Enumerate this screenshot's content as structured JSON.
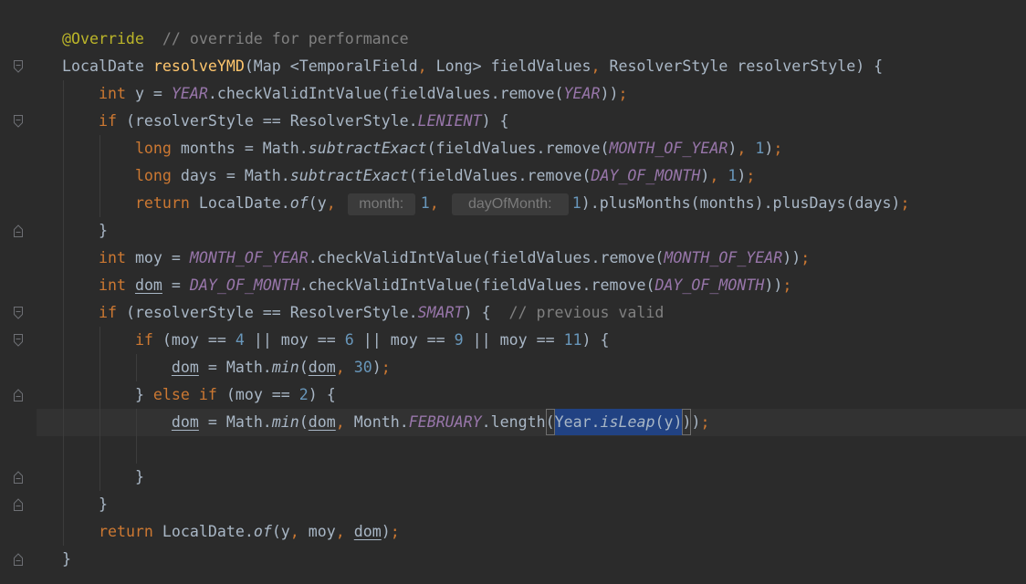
{
  "editor": {
    "colors": {
      "background": "#2B2B2B",
      "current_line": "#323232",
      "selection": "#214283",
      "text": "#A9B7C6",
      "keyword": "#CC7832",
      "annotation": "#BBB529",
      "method_declaration": "#FFC66D",
      "constant": "#9876AA",
      "number": "#6897BB",
      "comment": "#808080",
      "hint_text": "#7A7A7A",
      "hint_background": "#3B3B3B",
      "indent_guide": "#3C3C3C",
      "match_border": "#6E6E6E"
    },
    "caret_line": 14,
    "lines": [
      {
        "tokens": [
          {
            "t": "@Override",
            "c": "#BBB529"
          },
          {
            "t": "  "
          },
          {
            "t": "// override for performance",
            "c": "#808080"
          }
        ]
      },
      {
        "fold_icon": "fold-start-icon",
        "tokens": [
          {
            "t": "LocalDate "
          },
          {
            "t": "resolveYMD",
            "c": "#FFC66D"
          },
          {
            "t": "(Map <TemporalField"
          },
          {
            "t": ",",
            "c": "#CC7832"
          },
          {
            "t": " Long> fieldValues"
          },
          {
            "t": ",",
            "c": "#CC7832"
          },
          {
            "t": " ResolverStyle resolverStyle) {"
          }
        ]
      },
      {
        "tokens": [
          {
            "t": "    "
          },
          {
            "t": "int",
            "c": "#CC7832"
          },
          {
            "t": " y = "
          },
          {
            "t": "YEAR",
            "c": "#9876AA",
            "i": true
          },
          {
            "t": ".checkValidIntValue(fieldValues.remove("
          },
          {
            "t": "YEAR",
            "c": "#9876AA",
            "i": true
          },
          {
            "t": "))"
          },
          {
            "t": ";",
            "c": "#CC7832"
          }
        ]
      },
      {
        "fold_icon": "fold-start-icon",
        "tokens": [
          {
            "t": "    "
          },
          {
            "t": "if",
            "c": "#CC7832"
          },
          {
            "t": " (resolverStyle == ResolverStyle."
          },
          {
            "t": "LENIENT",
            "c": "#9876AA",
            "i": true
          },
          {
            "t": ") {"
          }
        ]
      },
      {
        "tokens": [
          {
            "t": "        "
          },
          {
            "t": "long",
            "c": "#CC7832"
          },
          {
            "t": " months = Math."
          },
          {
            "t": "subtractExact",
            "i": true
          },
          {
            "t": "(fieldValues.remove("
          },
          {
            "t": "MONTH_OF_YEAR",
            "c": "#9876AA",
            "i": true
          },
          {
            "t": ")"
          },
          {
            "t": ",",
            "c": "#CC7832"
          },
          {
            "t": " "
          },
          {
            "t": "1",
            "c": "#6897BB"
          },
          {
            "t": ")"
          },
          {
            "t": ";",
            "c": "#CC7832"
          }
        ]
      },
      {
        "tokens": [
          {
            "t": "        "
          },
          {
            "t": "long",
            "c": "#CC7832"
          },
          {
            "t": " days = Math."
          },
          {
            "t": "subtractExact",
            "i": true
          },
          {
            "t": "(fieldValues.remove("
          },
          {
            "t": "DAY_OF_MONTH",
            "c": "#9876AA",
            "i": true
          },
          {
            "t": ")"
          },
          {
            "t": ",",
            "c": "#CC7832"
          },
          {
            "t": " "
          },
          {
            "t": "1",
            "c": "#6897BB"
          },
          {
            "t": ")"
          },
          {
            "t": ";",
            "c": "#CC7832"
          }
        ]
      },
      {
        "tokens": [
          {
            "t": "        "
          },
          {
            "t": "return",
            "c": "#CC7832"
          },
          {
            "t": " LocalDate."
          },
          {
            "t": "of",
            "i": true
          },
          {
            "t": "(y"
          },
          {
            "t": ",",
            "c": "#CC7832"
          },
          {
            "t": " "
          },
          {
            "t": "month:",
            "hint": true
          },
          {
            "t": "1",
            "c": "#6897BB"
          },
          {
            "t": ",",
            "c": "#CC7832"
          },
          {
            "t": " "
          },
          {
            "t": "dayOfMonth:",
            "hint": true
          },
          {
            "t": "1",
            "c": "#6897BB"
          },
          {
            "t": ").plusMonths(months).plusDays(days)"
          },
          {
            "t": ";",
            "c": "#CC7832"
          }
        ]
      },
      {
        "fold_icon": "fold-end-icon",
        "tokens": [
          {
            "t": "    "
          },
          {
            "t": "}"
          }
        ]
      },
      {
        "tokens": [
          {
            "t": "    "
          },
          {
            "t": "int",
            "c": "#CC7832"
          },
          {
            "t": " moy = "
          },
          {
            "t": "MONTH_OF_YEAR",
            "c": "#9876AA",
            "i": true
          },
          {
            "t": ".checkValidIntValue(fieldValues.remove("
          },
          {
            "t": "MONTH_OF_YEAR",
            "c": "#9876AA",
            "i": true
          },
          {
            "t": "))"
          },
          {
            "t": ";",
            "c": "#CC7832"
          }
        ]
      },
      {
        "tokens": [
          {
            "t": "    "
          },
          {
            "t": "int",
            "c": "#CC7832"
          },
          {
            "t": " "
          },
          {
            "t": "dom",
            "u": true
          },
          {
            "t": " = "
          },
          {
            "t": "DAY_OF_MONTH",
            "c": "#9876AA",
            "i": true
          },
          {
            "t": ".checkValidIntValue(fieldValues.remove("
          },
          {
            "t": "DAY_OF_MONTH",
            "c": "#9876AA",
            "i": true
          },
          {
            "t": "))"
          },
          {
            "t": ";",
            "c": "#CC7832"
          }
        ]
      },
      {
        "fold_icon": "fold-start-icon",
        "tokens": [
          {
            "t": "    "
          },
          {
            "t": "if",
            "c": "#CC7832"
          },
          {
            "t": " (resolverStyle == ResolverStyle."
          },
          {
            "t": "SMART",
            "c": "#9876AA",
            "i": true
          },
          {
            "t": ") {  "
          },
          {
            "t": "// previous valid",
            "c": "#808080"
          }
        ]
      },
      {
        "fold_icon": "fold-start-icon",
        "tokens": [
          {
            "t": "        "
          },
          {
            "t": "if",
            "c": "#CC7832"
          },
          {
            "t": " (moy == "
          },
          {
            "t": "4",
            "c": "#6897BB"
          },
          {
            "t": " || moy == "
          },
          {
            "t": "6",
            "c": "#6897BB"
          },
          {
            "t": " || moy == "
          },
          {
            "t": "9",
            "c": "#6897BB"
          },
          {
            "t": " || moy == "
          },
          {
            "t": "11",
            "c": "#6897BB"
          },
          {
            "t": ") {"
          }
        ]
      },
      {
        "tokens": [
          {
            "t": "            "
          },
          {
            "t": "dom",
            "u": true
          },
          {
            "t": " = Math."
          },
          {
            "t": "min",
            "i": true
          },
          {
            "t": "("
          },
          {
            "t": "dom",
            "u": true
          },
          {
            "t": ",",
            "c": "#CC7832"
          },
          {
            "t": " "
          },
          {
            "t": "30",
            "c": "#6897BB"
          },
          {
            "t": ")"
          },
          {
            "t": ";",
            "c": "#CC7832"
          }
        ]
      },
      {
        "fold_icon": "fold-end-icon",
        "tokens": [
          {
            "t": "        "
          },
          {
            "t": "} "
          },
          {
            "t": "else if",
            "c": "#CC7832"
          },
          {
            "t": " (moy == "
          },
          {
            "t": "2",
            "c": "#6897BB"
          },
          {
            "t": ") {"
          }
        ]
      },
      {
        "tokens": [
          {
            "t": "            "
          },
          {
            "t": "dom",
            "u": true
          },
          {
            "t": " = Math."
          },
          {
            "t": "min",
            "i": true
          },
          {
            "t": "("
          },
          {
            "t": "dom",
            "u": true
          },
          {
            "t": ",",
            "c": "#CC7832"
          },
          {
            "t": " Month."
          },
          {
            "t": "FEBRUARY",
            "c": "#9876AA",
            "i": true
          },
          {
            "t": ".length"
          },
          {
            "t": "(",
            "match": true
          },
          {
            "t": "Year.",
            "sel": true
          },
          {
            "t": "isLeap",
            "i": true,
            "sel": true
          },
          {
            "t": "(y)",
            "sel": true
          },
          {
            "t": ")",
            "match": true
          },
          {
            "t": ")"
          },
          {
            "t": ";",
            "c": "#CC7832"
          }
        ]
      },
      {
        "tokens": []
      },
      {
        "fold_icon": "fold-end-icon",
        "tokens": [
          {
            "t": "        "
          },
          {
            "t": "}"
          }
        ]
      },
      {
        "fold_icon": "fold-end-icon",
        "tokens": [
          {
            "t": "    "
          },
          {
            "t": "}"
          }
        ]
      },
      {
        "tokens": [
          {
            "t": "    "
          },
          {
            "t": "return",
            "c": "#CC7832"
          },
          {
            "t": " LocalDate."
          },
          {
            "t": "of",
            "i": true
          },
          {
            "t": "(y"
          },
          {
            "t": ",",
            "c": "#CC7832"
          },
          {
            "t": " moy"
          },
          {
            "t": ",",
            "c": "#CC7832"
          },
          {
            "t": " "
          },
          {
            "t": "dom",
            "u": true
          },
          {
            "t": ")"
          },
          {
            "t": ";",
            "c": "#CC7832"
          }
        ]
      },
      {
        "fold_icon": "fold-end-icon",
        "tokens": [
          {
            "t": "}"
          }
        ]
      }
    ]
  }
}
